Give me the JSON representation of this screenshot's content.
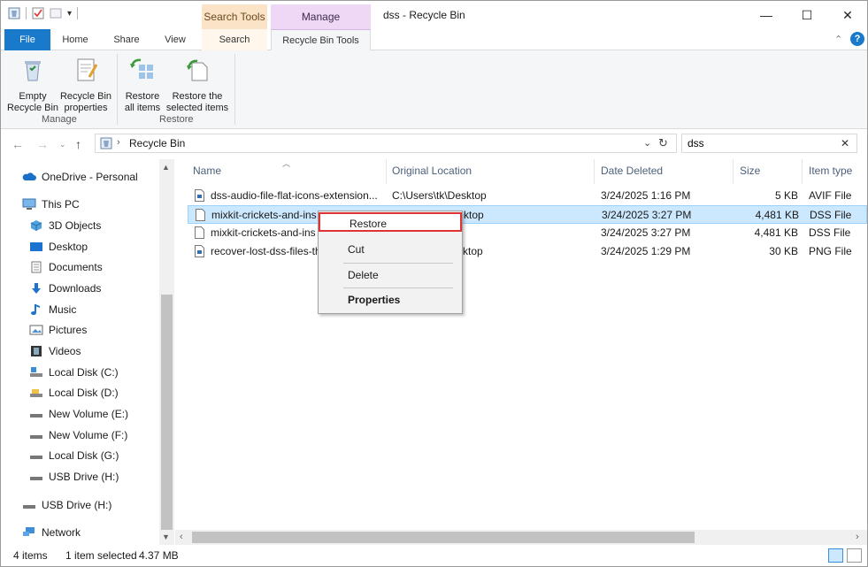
{
  "window": {
    "title": "dss - Recycle Bin",
    "minimize": "—",
    "maximize": "☐",
    "close": "✕"
  },
  "contextual_tabs": {
    "search_tools": "Search Tools",
    "manage": "Manage"
  },
  "ribbon_tabs": {
    "file": "File",
    "home": "Home",
    "share": "Share",
    "view": "View",
    "search": "Search",
    "recycle_bin_tools": "Recycle Bin Tools"
  },
  "ribbon": {
    "empty_bin": [
      "Empty",
      "Recycle Bin"
    ],
    "bin_properties": [
      "Recycle Bin",
      "properties"
    ],
    "restore_all": [
      "Restore",
      "all items"
    ],
    "restore_selected": [
      "Restore the",
      "selected items"
    ],
    "group_manage": "Manage",
    "group_restore": "Restore"
  },
  "address": {
    "path": "Recycle Bin",
    "search_value": "dss"
  },
  "nav_pane": {
    "onedrive": "OneDrive - Personal",
    "this_pc": "This PC",
    "items": [
      "3D Objects",
      "Desktop",
      "Documents",
      "Downloads",
      "Music",
      "Pictures",
      "Videos",
      "Local Disk (C:)",
      "Local Disk (D:)",
      "New Volume (E:)",
      "New Volume (F:)",
      "Local Disk (G:)",
      "USB Drive (H:)"
    ],
    "usb_root": "USB Drive (H:)",
    "network": "Network"
  },
  "columns": {
    "name": "Name",
    "original_location": "Original Location",
    "date_deleted": "Date Deleted",
    "size": "Size",
    "item_type": "Item type"
  },
  "files": [
    {
      "name": "dss-audio-file-flat-icons-extension...",
      "location": "C:\\Users\\tk\\Desktop",
      "date": "3/24/2025 1:16 PM",
      "size": "5 KB",
      "type": "AVIF File"
    },
    {
      "name": "mixkit-crickets-and-ins",
      "location": "ktop",
      "date": "3/24/2025 3:27 PM",
      "size": "4,481 KB",
      "type": "DSS File"
    },
    {
      "name": "mixkit-crickets-and-ins",
      "location": "",
      "date": "3/24/2025 3:27 PM",
      "size": "4,481 KB",
      "type": "DSS File"
    },
    {
      "name": "recover-lost-dss-files-th",
      "location": "ktop",
      "date": "3/24/2025 1:29 PM",
      "size": "30 KB",
      "type": "PNG File"
    }
  ],
  "context_menu": {
    "restore": "Restore",
    "cut": "Cut",
    "delete": "Delete",
    "properties": "Properties"
  },
  "status": {
    "count": "4 items",
    "selection": "1 item selected",
    "size": "4.37 MB"
  },
  "colors": {
    "file_tab": "#1979ca",
    "search_tools": "#fbe3c8",
    "manage": "#eed8f5",
    "selection": "#cce8ff",
    "highlight_border": "#e03434"
  }
}
